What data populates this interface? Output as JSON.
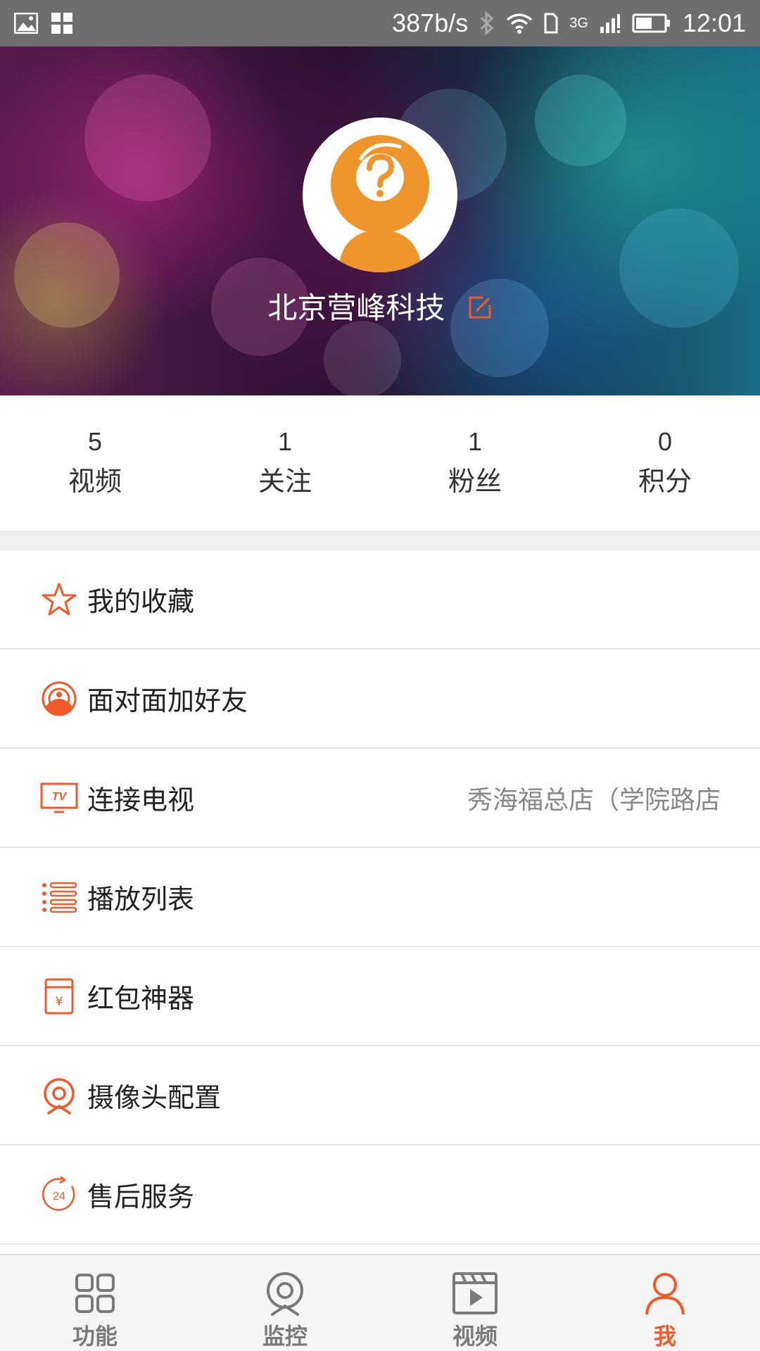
{
  "status_bar": {
    "network_speed": "387b/s",
    "network_type": "3G",
    "time": "12:01",
    "icons": [
      "image-icon",
      "app-grid-icon",
      "bluetooth-icon",
      "wifi-icon",
      "sim-icon",
      "signal-icon",
      "battery-icon"
    ]
  },
  "profile": {
    "name": "北京营峰科技",
    "avatar_icon": "default-avatar-icon",
    "edit_icon": "edit-icon"
  },
  "stats": [
    {
      "value": "5",
      "label": "视频"
    },
    {
      "value": "1",
      "label": "关注"
    },
    {
      "value": "1",
      "label": "粉丝"
    },
    {
      "value": "0",
      "label": "积分"
    }
  ],
  "menu": [
    {
      "label": "我的收藏",
      "icon": "star-icon",
      "value": ""
    },
    {
      "label": "面对面加好友",
      "icon": "radar-icon",
      "value": ""
    },
    {
      "label": "连接电视",
      "icon": "tv-icon",
      "value": "秀海福总店（学院路店"
    },
    {
      "label": "播放列表",
      "icon": "list-icon",
      "value": ""
    },
    {
      "label": "红包神器",
      "icon": "red-packet-icon",
      "value": ""
    },
    {
      "label": "摄像头配置",
      "icon": "camera-icon",
      "value": ""
    },
    {
      "label": "售后服务",
      "icon": "service-24-icon",
      "value": ""
    }
  ],
  "bottom_nav": {
    "items": [
      {
        "label": "功能",
        "icon": "grid-icon",
        "active": false
      },
      {
        "label": "监控",
        "icon": "monitor-camera-icon",
        "active": false
      },
      {
        "label": "视频",
        "icon": "video-icon",
        "active": false
      },
      {
        "label": "我",
        "icon": "person-icon",
        "active": true
      }
    ]
  },
  "colors": {
    "accent": "#f05a28",
    "status_bar_bg": "#6f6f6f",
    "nav_inactive": "#7a7a7a",
    "avatar_orange": "#f0952c"
  }
}
